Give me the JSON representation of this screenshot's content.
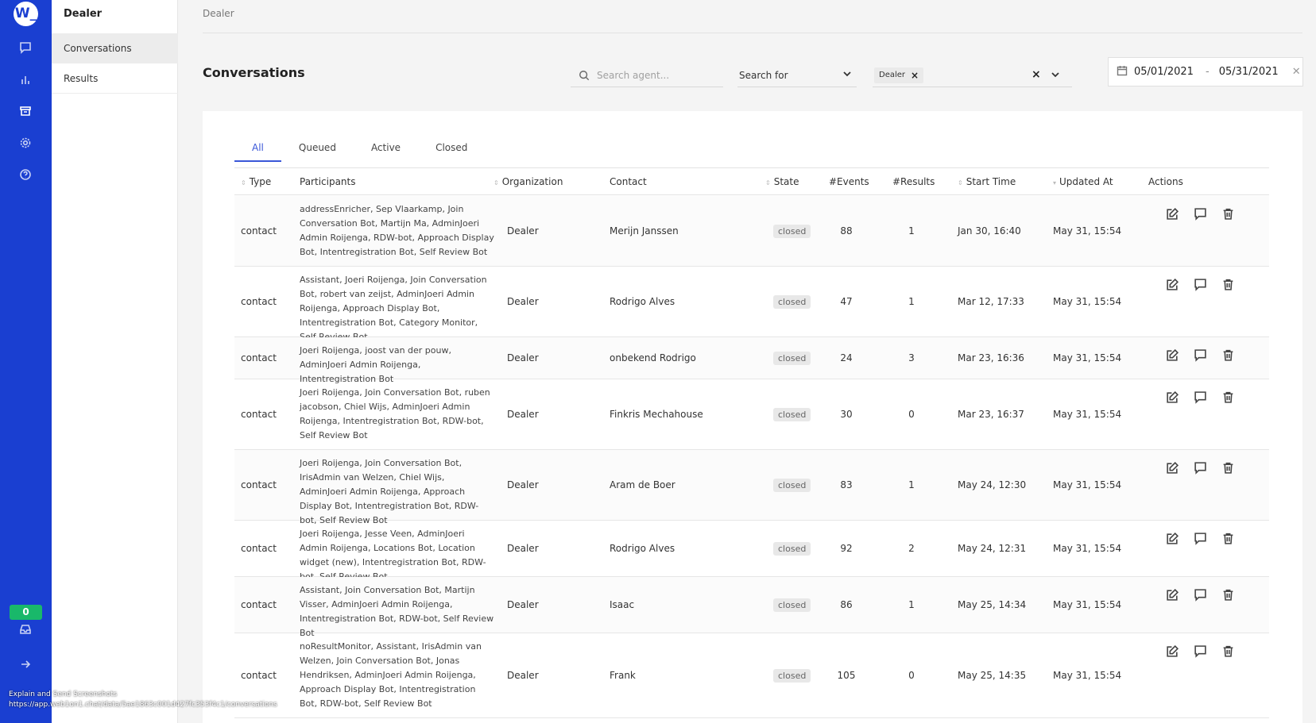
{
  "app": {
    "logo_text": "W_"
  },
  "rail": {
    "icons": [
      "chat-icon",
      "bar-chart-icon",
      "archive-icon",
      "gear-icon",
      "help-icon",
      "inbox-icon",
      "arrow-right-icon"
    ],
    "badge_count": "0"
  },
  "subnav": {
    "title": "Dealer",
    "items": [
      {
        "label": "Conversations"
      },
      {
        "label": "Results"
      }
    ]
  },
  "breadcrumb": "Dealer",
  "page_title": "Conversations",
  "filters": {
    "search_placeholder": "Search agent...",
    "search_for_label": "Search for",
    "tag_label": "Dealer",
    "date_from": "05/01/2021",
    "date_sep": "-",
    "date_to": "05/31/2021"
  },
  "tabs": [
    {
      "label": "All"
    },
    {
      "label": "Queued"
    },
    {
      "label": "Active"
    },
    {
      "label": "Closed"
    }
  ],
  "columns": {
    "type": "Type",
    "participants": "Participants",
    "organization": "Organization",
    "contact": "Contact",
    "state": "State",
    "events": "#Events",
    "results": "#Results",
    "start_time": "Start Time",
    "updated_at": "Updated At",
    "actions": "Actions"
  },
  "rows": [
    {
      "type": "contact",
      "participants": "addressEnricher, Sep Vlaarkamp, Join Conversation Bot, Martijn Ma, AdminJoeri Admin Roijenga, RDW-bot, Approach Display Bot, Intentregistration Bot, Self Review Bot",
      "organization": "Dealer",
      "contact": "Merijn Janssen",
      "state": "closed",
      "events": "88",
      "results": "1",
      "start": "Jan 30, 16:40",
      "updated": "May 31, 15:54"
    },
    {
      "type": "contact",
      "participants": "Assistant, Joeri Roijenga, Join Conversation Bot, robert van zeijst, AdminJoeri Admin Roijenga, Approach Display Bot, Intentregistration Bot, Category Monitor, Self Review Bot",
      "organization": "Dealer",
      "contact": "Rodrigo Alves",
      "state": "closed",
      "events": "47",
      "results": "1",
      "start": "Mar 12, 17:33",
      "updated": "May 31, 15:54"
    },
    {
      "type": "contact",
      "participants": "Joeri Roijenga, joost van der pouw, AdminJoeri Admin Roijenga, Intentregistration Bot",
      "organization": "Dealer",
      "contact": "onbekend Rodrigo",
      "state": "closed",
      "events": "24",
      "results": "3",
      "start": "Mar 23, 16:36",
      "updated": "May 31, 15:54"
    },
    {
      "type": "contact",
      "participants": "Joeri Roijenga, Join Conversation Bot, ruben jacobson, Chiel Wijs, AdminJoeri Admin Roijenga, Intentregistration Bot, RDW-bot, Self Review Bot",
      "organization": "Dealer",
      "contact": "Finkris Mechahouse",
      "state": "closed",
      "events": "30",
      "results": "0",
      "start": "Mar 23, 16:37",
      "updated": "May 31, 15:54"
    },
    {
      "type": "contact",
      "participants": "Joeri Roijenga, Join Conversation Bot, IrisAdmin van Welzen, Chiel Wijs, AdminJoeri Admin Roijenga, Approach Display Bot, Intentregistration Bot, RDW-bot, Self Review Bot",
      "organization": "Dealer",
      "contact": "Aram de Boer",
      "state": "closed",
      "events": "83",
      "results": "1",
      "start": "May 24, 12:30",
      "updated": "May 31, 15:54"
    },
    {
      "type": "contact",
      "participants": "Joeri Roijenga, Jesse Veen, AdminJoeri Admin Roijenga, Locations Bot, Location widget (new), Intentregistration Bot, RDW-bot, Self Review Bot",
      "organization": "Dealer",
      "contact": "Rodrigo Alves",
      "state": "closed",
      "events": "92",
      "results": "2",
      "start": "May 24, 12:31",
      "updated": "May 31, 15:54"
    },
    {
      "type": "contact",
      "participants": "Assistant, Join Conversation Bot, Martijn Visser, AdminJoeri Admin Roijenga, Intentregistration Bot, RDW-bot, Self Review Bot",
      "organization": "Dealer",
      "contact": "Isaac",
      "state": "closed",
      "events": "86",
      "results": "1",
      "start": "May 25, 14:34",
      "updated": "May 31, 15:54"
    },
    {
      "type": "contact",
      "participants": "noResultMonitor, Assistant, IrisAdmin van Welzen, Join Conversation Bot, Jonas Hendriksen, AdminJoeri Admin Roijenga, Approach Display Bot, Intentregistration Bot, RDW-bot, Self Review Bot",
      "organization": "Dealer",
      "contact": "Frank",
      "state": "closed",
      "events": "105",
      "results": "0",
      "start": "May 25, 14:35",
      "updated": "May 31, 15:54"
    }
  ],
  "overlay": {
    "line1": "Explain and Send Screenshots",
    "line2": "https://app.web1on1.chat/data/5ae1863c001d427fc353f4c1/conversations"
  }
}
